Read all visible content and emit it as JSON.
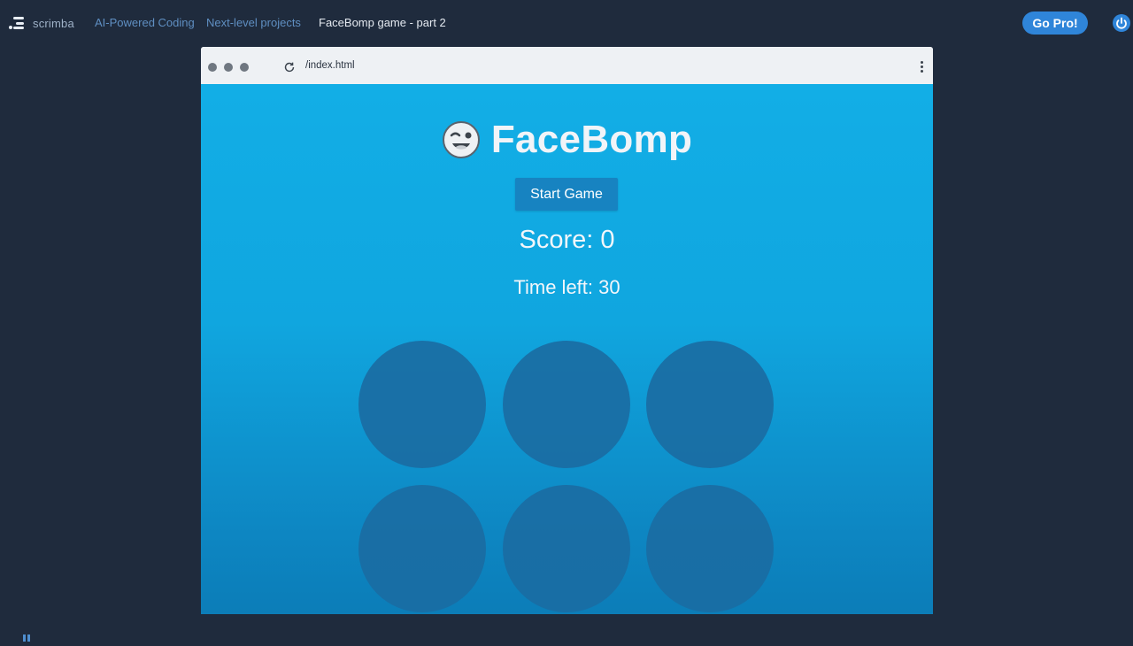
{
  "topbar": {
    "brand": "scrimba",
    "breadcrumbs": [
      "AI-Powered Coding",
      "Next-level projects",
      "FaceBomp game - part 2"
    ],
    "gopro_label": "Go Pro!"
  },
  "browser": {
    "url": "/index.html"
  },
  "game": {
    "title": "FaceBomp",
    "title_icon": "smiling-face-icon",
    "start_label": "Start Game",
    "score_text": "Score: 0",
    "time_text": "Time left: 30",
    "hole_count": 6
  },
  "colors": {
    "page_background": "#1f2b3d",
    "game_background": "#12aee6",
    "hole": "#1a6da3",
    "button": "#1783c1",
    "gopro": "#2f85d9"
  }
}
